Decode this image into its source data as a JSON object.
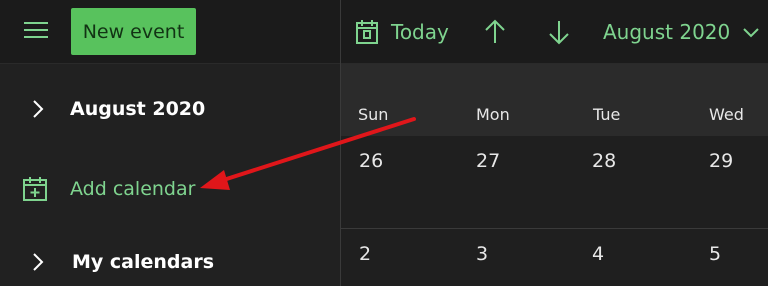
{
  "toolbar": {
    "new_event_label": "New event",
    "today_label": "Today",
    "month_label": "August 2020"
  },
  "sidebar": {
    "month_label": "August 2020",
    "add_calendar_label": "Add calendar",
    "my_calendars_label": "My calendars"
  },
  "calendar": {
    "day_names": [
      "Sun",
      "Mon",
      "Tue",
      "Wed"
    ],
    "weeks": [
      [
        "26",
        "27",
        "28",
        "29"
      ],
      [
        "2",
        "3",
        "4",
        "5"
      ]
    ]
  },
  "colors": {
    "accent": "#7fd48f",
    "button_bg": "#58c25d",
    "annotation_arrow": "#e0161a"
  }
}
